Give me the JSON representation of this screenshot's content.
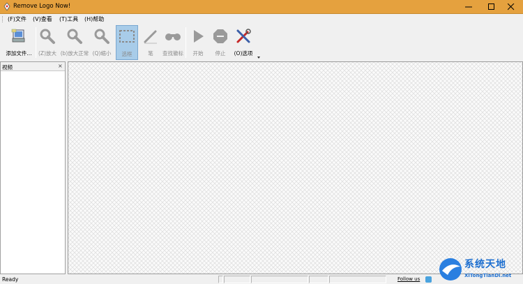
{
  "window": {
    "title": "Remove Logo Now!",
    "minimize_icon": "minimize-icon",
    "maximize_icon": "maximize-icon",
    "close_icon": "close-icon"
  },
  "menu": [
    {
      "label": "(F)文件"
    },
    {
      "label": "(V)查看"
    },
    {
      "label": "(T)工具"
    },
    {
      "label": "(H)帮助"
    }
  ],
  "toolbar": {
    "add_file": "添加文件...",
    "zoom_in": "(Z)放大",
    "zoom_normal": "(b)放大正常",
    "zoom_out": "(Q)缩小",
    "select": "选框",
    "pen": "笔",
    "find_logo": "查找徽标",
    "start": "开始",
    "stop": "停止",
    "options": "(O)选项"
  },
  "sidebar": {
    "title": "视频",
    "close_glyph": "×"
  },
  "status": {
    "text": "Ready",
    "follow": "Follow us"
  },
  "watermark": {
    "line1": "系统天地",
    "line2": "XiTongTianDi.net"
  },
  "colors": {
    "titlebar": "#e5a13e",
    "active_tool": "#a8cce9",
    "watermark_blue": "#1d6fd0"
  }
}
